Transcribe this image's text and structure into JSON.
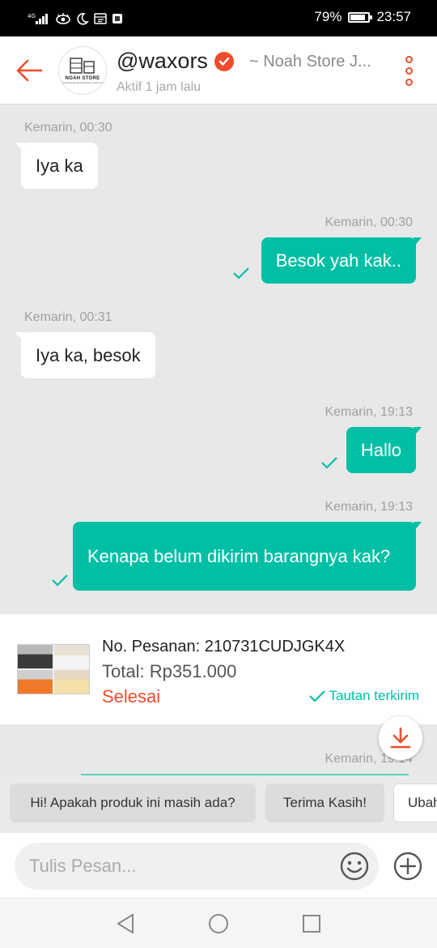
{
  "status_bar": {
    "network": "4G",
    "battery": "79%",
    "time": "23:57"
  },
  "header": {
    "username": "@waxors",
    "store_name": "~ Noah Store J...",
    "active_status": "Aktif 1 jam lalu",
    "avatar_text": "NOAH STORE",
    "avatar_subtext": "Tempat gudang kebutuhan rumah anda"
  },
  "messages": [
    {
      "direction": "in",
      "time": "Kemarin, 00:30",
      "text": "Iya ka"
    },
    {
      "direction": "out",
      "time": "Kemarin, 00:30",
      "text": "Besok yah kak..",
      "read": true
    },
    {
      "direction": "in",
      "time": "Kemarin, 00:31",
      "text": "Iya ka, besok"
    },
    {
      "direction": "out",
      "time": "Kemarin, 19:13",
      "text": "Hallo",
      "read": true
    },
    {
      "direction": "out",
      "time": "Kemarin, 19:13",
      "text": "Kenapa belum dikirim barangnya kak?",
      "read": true
    }
  ],
  "order": {
    "order_number": "No. Pesanan: 210731CUDJGK4X",
    "total": "Total: Rp351.000",
    "status": "Selesai",
    "link_status": "Tautan terkirim"
  },
  "next_message_time": "Kemarin, 19:14",
  "quick_replies": [
    "Hi! Apakah produk ini masih ada?",
    "Terima Kasih!",
    "Ubah"
  ],
  "input": {
    "placeholder": "Tulis Pesan..."
  },
  "colors": {
    "accent": "#ee4d2d",
    "outgoing_bubble": "#00bfa5",
    "incoming_bubble": "#ffffff",
    "chat_background": "#e8e8e8"
  },
  "icons": [
    "back-arrow-icon",
    "verified-icon",
    "more-vertical-icon",
    "check-icon",
    "scroll-down-icon",
    "emoji-icon",
    "plus-icon",
    "nav-back-icon",
    "nav-home-icon",
    "nav-recent-icon"
  ]
}
